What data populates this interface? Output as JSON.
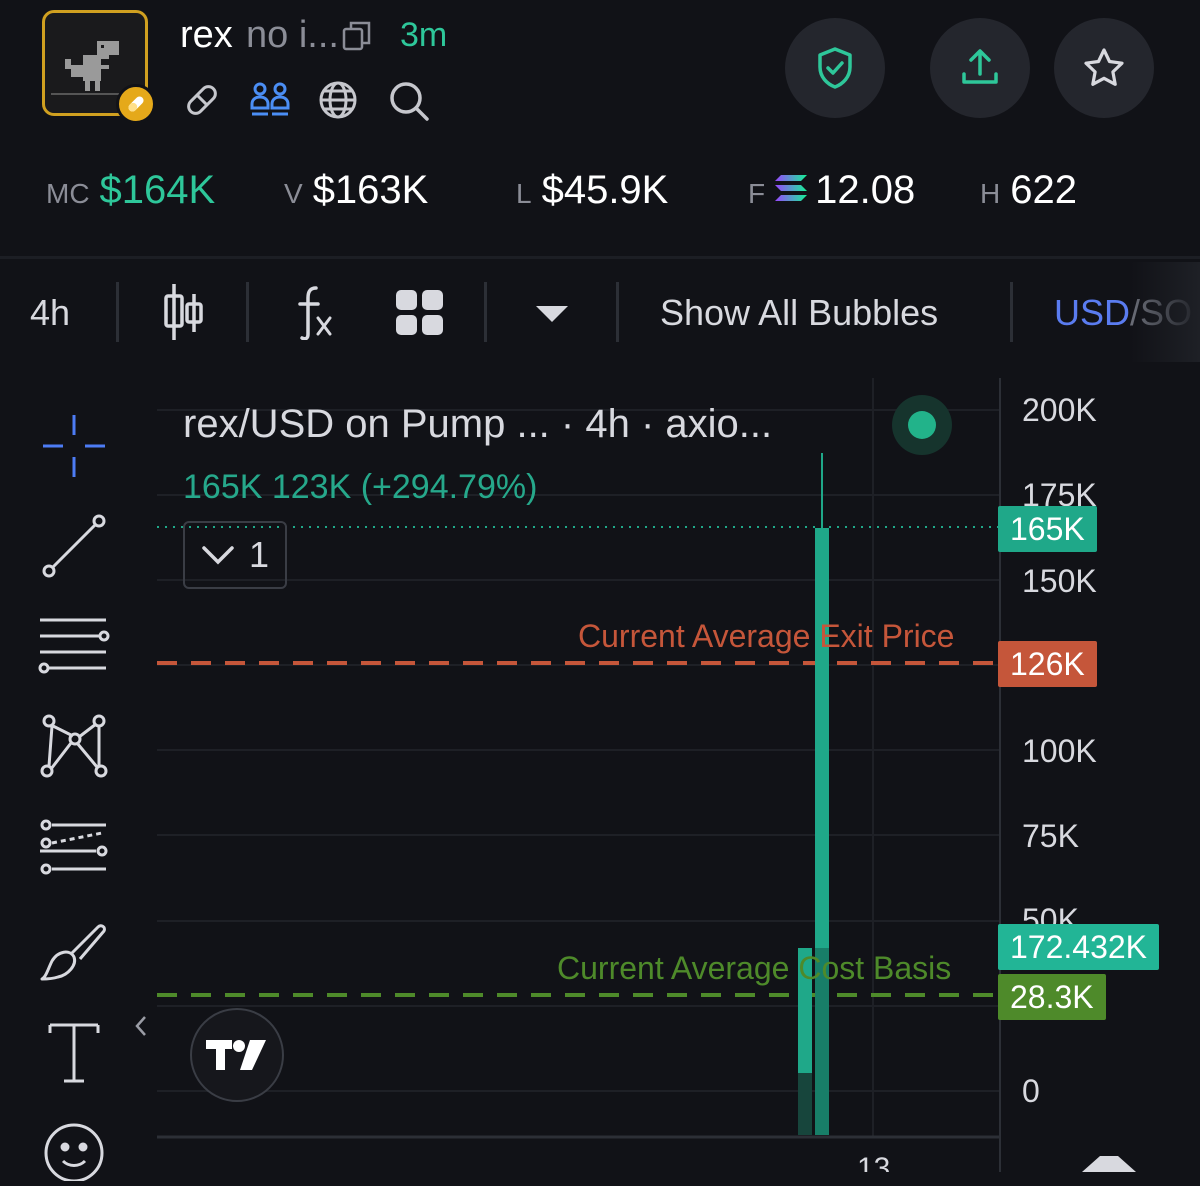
{
  "token": {
    "symbol": "rex",
    "name_truncated": "no i...",
    "age": "3m"
  },
  "stats": [
    {
      "label": "MC",
      "value": "$164K"
    },
    {
      "label": "V",
      "value": "$163K"
    },
    {
      "label": "L",
      "value": "$45.9K"
    },
    {
      "label": "F",
      "value": "12.08"
    },
    {
      "label": "H",
      "value": "622"
    }
  ],
  "toolbar": {
    "interval": "4h",
    "bubbles_label": "Show All Bubbles",
    "currency_usd": "USD",
    "currency_sep": "/",
    "currency_sol": "SO"
  },
  "chart": {
    "legend_title": "rex/USD on Pump ... · 4h · axio...",
    "legend_values": "165K  123K (+294.79%)",
    "legend_toggle_count": "1",
    "avg_exit_label": "Current Average Exit Price",
    "avg_cost_label": "Current Average Cost Basis",
    "y_axis_labels": [
      "200K",
      "175K",
      "150K",
      "100K",
      "75K",
      "50K",
      "0"
    ],
    "price_tags": {
      "last": "165K",
      "exit": "126K",
      "market": "172.432K",
      "cost": "28.3K"
    },
    "colors": {
      "up": "#1fa889",
      "exit": "#c5563a",
      "cost": "#4e8a2a",
      "accent": "#2ec79a",
      "link": "#5a7cf0"
    }
  }
}
